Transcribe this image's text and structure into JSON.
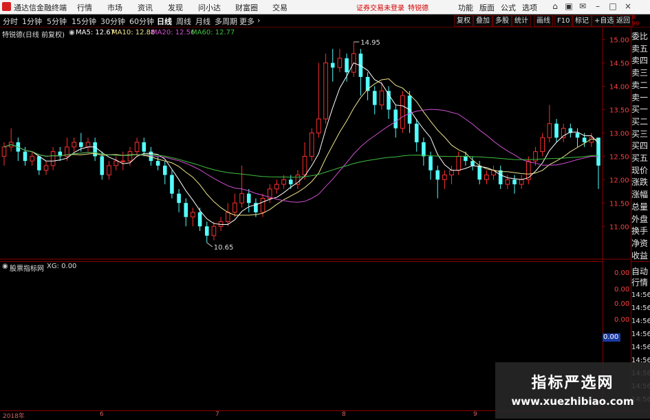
{
  "app": {
    "title": "通达信金融终端"
  },
  "top_menu": [
    "行情",
    "市场",
    "资讯",
    "发现",
    "问小达",
    "财富圈",
    "交易"
  ],
  "notice": {
    "warn": "证券交易未登录",
    "stock": "特锐德"
  },
  "top_right": [
    "功能",
    "版面",
    "公式",
    "选项"
  ],
  "periods": [
    "分时",
    "1分钟",
    "5分钟",
    "15分钟",
    "30分钟",
    "60分钟",
    "日线",
    "周线",
    "月线",
    "多周期",
    "更多"
  ],
  "active_period": "日线",
  "right_buttons": [
    "复权",
    "叠加",
    "多股",
    "统计",
    "画线",
    "F10",
    "标记",
    "+自选",
    "返回"
  ],
  "chart_header": {
    "stock": "特锐德(日线 前复权)",
    "ma5": "MA5: 12.67",
    "ma10": "MA10: 12.88",
    "ma20": "MA20: 12.56",
    "ma60": "MA60: 12.77",
    "ma5_color": "#ffffff",
    "ma10_color": "#f0e68c",
    "ma20_color": "#d050d0",
    "ma60_color": "#40c040"
  },
  "price_axis": [
    "15.00",
    "14.50",
    "14.00",
    "13.50",
    "13.00",
    "12.50",
    "12.00",
    "11.50",
    "11.00"
  ],
  "annotations": {
    "high": "14.95",
    "low": "10.65"
  },
  "side_labels": [
    "委比",
    "卖五",
    "卖四",
    "卖三",
    "卖二",
    "卖一",
    "买一",
    "买二",
    "买三",
    "买四",
    "买五",
    "现价",
    "涨跌",
    "涨幅",
    "总量",
    "外盘",
    "换手",
    "净资",
    "收益"
  ],
  "lower": {
    "title": "股票指标网",
    "xg": "XG: 0.00",
    "axis": [
      "0.00",
      "0.00",
      "0.00",
      "0.00"
    ],
    "current": "0.00"
  },
  "lower_side": [
    "自动",
    "行情"
  ],
  "times": [
    "14:56",
    "14:56",
    "14:56",
    "14:56",
    "14:56",
    "14:56",
    "14:56",
    "14:56",
    "14:56"
  ],
  "dates": [
    "2018年",
    "6",
    "7",
    "8",
    "9"
  ],
  "watermark": {
    "line1": "指标严选网",
    "line2": "www.xuezhibiao.com"
  },
  "colors": {
    "up": "#ff3030",
    "down": "#54ffff",
    "grid_line": "#8b0000"
  },
  "candles": [
    [
      12.5,
      12.7,
      12.8,
      12.3
    ],
    [
      12.7,
      12.8,
      13.1,
      12.6
    ],
    [
      12.8,
      12.6,
      12.9,
      12.4
    ],
    [
      12.6,
      12.4,
      12.7,
      12.3
    ],
    [
      12.4,
      12.5,
      12.6,
      12.3
    ],
    [
      12.5,
      12.2,
      12.5,
      12.1
    ],
    [
      12.2,
      12.3,
      12.4,
      12.1
    ],
    [
      12.3,
      12.6,
      12.7,
      12.2
    ],
    [
      12.6,
      12.5,
      12.7,
      12.4
    ],
    [
      12.5,
      12.7,
      12.9,
      12.4
    ],
    [
      12.7,
      12.8,
      12.9,
      12.6
    ],
    [
      12.8,
      12.7,
      13.0,
      12.6
    ],
    [
      12.7,
      12.8,
      12.9,
      12.6
    ],
    [
      12.8,
      12.5,
      12.9,
      12.4
    ],
    [
      12.5,
      12.1,
      12.6,
      12.0
    ],
    [
      12.1,
      12.3,
      12.4,
      12.0
    ],
    [
      12.3,
      12.4,
      12.5,
      12.2
    ],
    [
      12.4,
      12.4,
      12.6,
      12.2
    ],
    [
      12.4,
      12.6,
      12.7,
      12.3
    ],
    [
      12.6,
      12.8,
      12.9,
      12.5
    ],
    [
      12.8,
      12.6,
      12.9,
      12.5
    ],
    [
      12.6,
      12.4,
      12.7,
      12.3
    ],
    [
      12.4,
      12.3,
      12.5,
      12.2
    ],
    [
      12.3,
      12.1,
      12.4,
      11.9
    ],
    [
      12.1,
      11.7,
      12.2,
      11.6
    ],
    [
      11.7,
      11.5,
      11.8,
      11.3
    ],
    [
      11.5,
      11.2,
      11.6,
      11.0
    ],
    [
      11.2,
      11.3,
      11.4,
      11.0
    ],
    [
      11.3,
      11.0,
      11.4,
      10.9
    ],
    [
      11.0,
      10.8,
      11.1,
      10.65
    ],
    [
      10.8,
      11.0,
      11.1,
      10.7
    ],
    [
      11.0,
      11.1,
      11.2,
      10.9
    ],
    [
      11.1,
      11.3,
      11.5,
      11.0
    ],
    [
      11.3,
      11.5,
      11.7,
      11.2
    ],
    [
      11.5,
      11.7,
      12.3,
      11.4
    ],
    [
      11.7,
      11.5,
      11.8,
      11.3
    ],
    [
      11.5,
      11.3,
      11.6,
      11.2
    ],
    [
      11.3,
      11.6,
      11.7,
      11.2
    ],
    [
      11.6,
      11.8,
      11.9,
      11.5
    ],
    [
      11.8,
      11.9,
      12.0,
      11.7
    ],
    [
      11.9,
      12.0,
      12.1,
      11.8
    ],
    [
      12.0,
      11.9,
      12.1,
      11.8
    ],
    [
      11.9,
      12.1,
      12.2,
      11.8
    ],
    [
      12.1,
      12.5,
      12.8,
      12.0
    ],
    [
      12.5,
      13.0,
      13.1,
      12.4
    ],
    [
      13.0,
      13.3,
      14.5,
      12.9
    ],
    [
      13.3,
      14.5,
      14.7,
      13.2
    ],
    [
      14.5,
      14.4,
      14.8,
      14.1
    ],
    [
      14.4,
      14.6,
      14.8,
      14.3
    ],
    [
      14.6,
      14.3,
      14.7,
      14.1
    ],
    [
      14.3,
      14.7,
      14.95,
      14.2
    ],
    [
      14.7,
      14.2,
      14.8,
      13.8
    ],
    [
      14.2,
      13.9,
      14.3,
      13.7
    ],
    [
      13.9,
      13.6,
      14.0,
      13.4
    ],
    [
      13.6,
      13.9,
      14.1,
      13.5
    ],
    [
      13.9,
      13.5,
      14.0,
      13.3
    ],
    [
      13.5,
      13.1,
      13.6,
      12.9
    ],
    [
      13.1,
      13.8,
      13.9,
      13.0
    ],
    [
      13.8,
      13.2,
      13.9,
      13.0
    ],
    [
      13.2,
      12.8,
      13.3,
      12.6
    ],
    [
      12.8,
      12.5,
      12.9,
      12.3
    ],
    [
      12.5,
      12.2,
      12.6,
      12.0
    ],
    [
      12.2,
      12.0,
      12.3,
      11.6
    ],
    [
      12.0,
      12.1,
      12.2,
      11.8
    ],
    [
      12.1,
      12.2,
      12.3,
      11.9
    ],
    [
      12.2,
      12.5,
      12.6,
      12.1
    ],
    [
      12.5,
      12.4,
      12.6,
      12.3
    ],
    [
      12.4,
      12.3,
      12.5,
      12.2
    ],
    [
      12.3,
      12.0,
      12.4,
      11.9
    ],
    [
      12.0,
      12.1,
      12.2,
      11.9
    ],
    [
      12.1,
      12.2,
      12.3,
      12.0
    ],
    [
      12.2,
      11.9,
      12.3,
      11.8
    ],
    [
      11.9,
      12.0,
      12.1,
      11.8
    ],
    [
      12.0,
      11.9,
      12.1,
      11.7
    ],
    [
      11.9,
      12.0,
      12.1,
      11.8
    ],
    [
      12.0,
      12.4,
      12.5,
      11.9
    ],
    [
      12.4,
      12.6,
      12.7,
      12.3
    ],
    [
      12.6,
      12.9,
      13.0,
      12.5
    ],
    [
      12.9,
      13.2,
      13.6,
      12.8
    ],
    [
      13.2,
      12.9,
      13.3,
      12.8
    ],
    [
      12.9,
      13.1,
      13.2,
      12.8
    ],
    [
      13.1,
      13.0,
      13.2,
      12.9
    ],
    [
      13.0,
      12.9,
      13.1,
      12.7
    ],
    [
      12.9,
      12.8,
      13.0,
      12.7
    ],
    [
      12.8,
      12.9,
      13.0,
      12.7
    ],
    [
      12.9,
      12.3,
      12.9,
      11.8
    ]
  ]
}
